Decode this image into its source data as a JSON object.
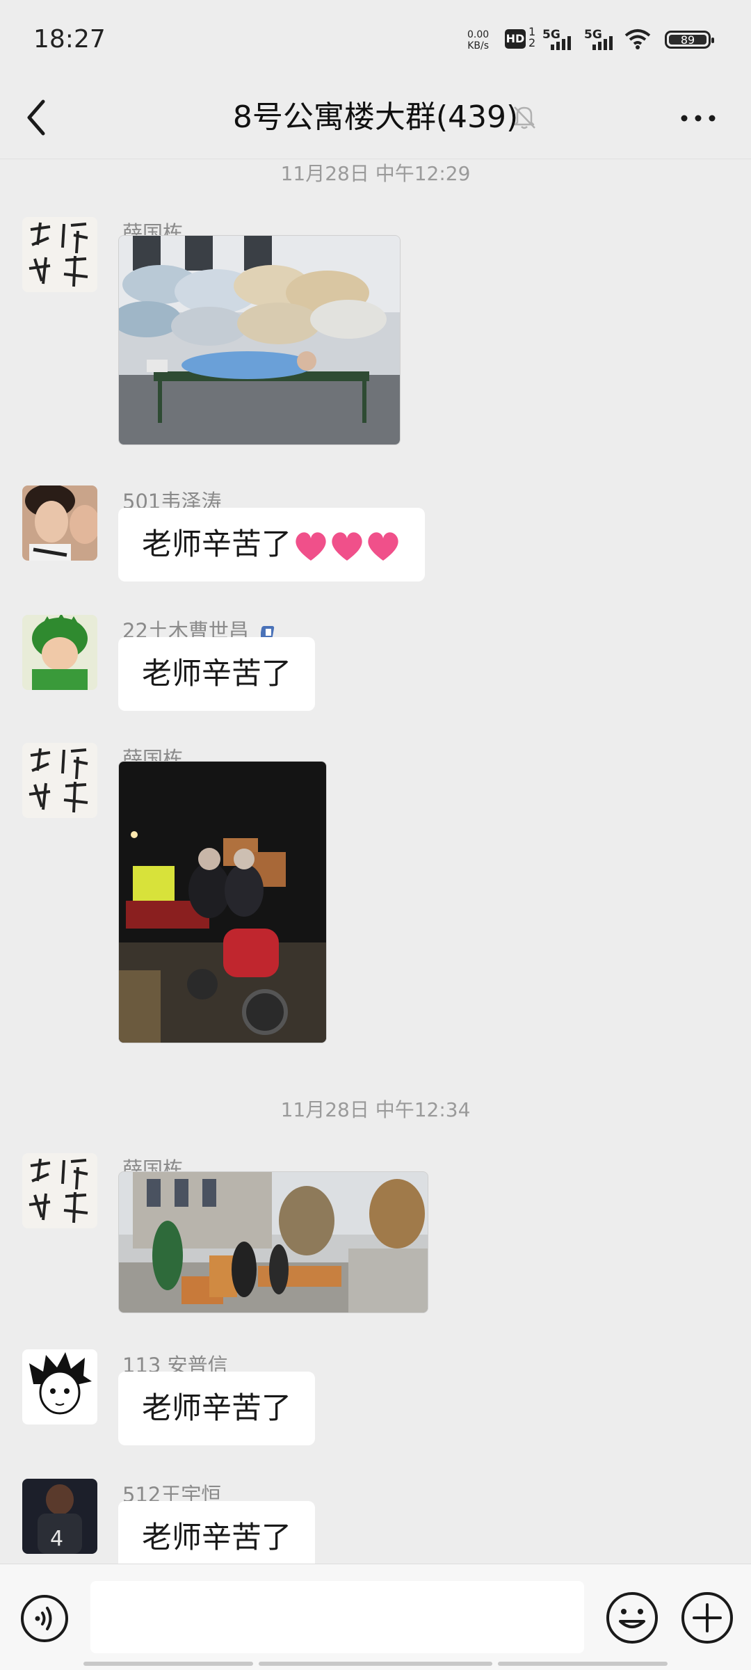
{
  "status_bar": {
    "time": "18:27",
    "net_speed_value": "0.00",
    "net_speed_unit": "KB/s",
    "hd_label": "HD",
    "hd_sub_top": "1",
    "hd_sub_bottom": "2",
    "signal1_label": "5G",
    "signal2_label": "5G",
    "battery_level": "89"
  },
  "header": {
    "title": "8号公寓楼大群(439)",
    "back_icon": "chevron-left-icon",
    "mute_icon": "bell-muted-icon",
    "more_icon": "more-dots-icon"
  },
  "chat": {
    "timestamps": [
      "11月28日 中午12:29",
      "11月28日 中午12:34"
    ],
    "messages": [
      {
        "sender": "薛国栋",
        "type": "image",
        "image_desc": "dormitory-beds-photo"
      },
      {
        "sender": "501韦泽涛",
        "type": "text",
        "text": "老师辛苦了",
        "emoji": "❤️❤️❤️"
      },
      {
        "sender": "22土木曹世昌",
        "type": "text",
        "text": "老师辛苦了"
      },
      {
        "sender": "薛国栋",
        "type": "image",
        "image_desc": "night-tricycle-photo"
      },
      {
        "sender": "薛国栋",
        "type": "image",
        "image_desc": "street-boxes-photo"
      },
      {
        "sender": "113 安普信",
        "type": "text",
        "text": "老师辛苦了"
      },
      {
        "sender": "512王宇恒",
        "type": "text",
        "text": "老师辛苦了"
      }
    ]
  },
  "input_bar": {
    "text_value": "",
    "voice_icon": "voice-icon",
    "emoji_icon": "emoji-icon",
    "plus_icon": "plus-circle-icon"
  },
  "colors": {
    "background": "#ededed",
    "bubble": "#ffffff",
    "name_text": "#8a8a8a",
    "heart": "#f0508a"
  }
}
